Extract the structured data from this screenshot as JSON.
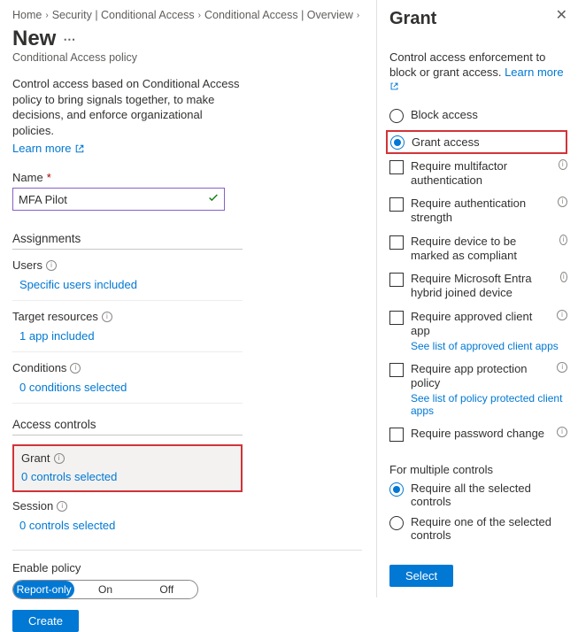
{
  "breadcrumb": {
    "items": [
      "Home",
      "Security | Conditional Access",
      "Conditional Access | Overview"
    ]
  },
  "page": {
    "title": "New",
    "subtitle": "Conditional Access policy",
    "description": "Control access based on Conditional Access policy to bring signals together, to make decisions, and enforce organizational policies.",
    "learn_more": "Learn more"
  },
  "name_field": {
    "label": "Name",
    "value": "MFA Pilot"
  },
  "assignments": {
    "header": "Assignments",
    "users": {
      "label": "Users",
      "link": "Specific users included"
    },
    "targets": {
      "label": "Target resources",
      "link": "1 app included"
    },
    "conditions": {
      "label": "Conditions",
      "link": "0 conditions selected"
    }
  },
  "access": {
    "header": "Access controls",
    "grant": {
      "label": "Grant",
      "link": "0 controls selected"
    },
    "session": {
      "label": "Session",
      "link": "0 controls selected"
    }
  },
  "enable": {
    "label": "Enable policy",
    "options": [
      "Report-only",
      "On",
      "Off"
    ],
    "selected": "Report-only"
  },
  "create_button": "Create",
  "panel": {
    "title": "Grant",
    "desc": "Control access enforcement to block or grant access.",
    "learn_more": "Learn more",
    "access_radio": {
      "block": "Block access",
      "grant": "Grant access",
      "selected": "grant"
    },
    "checks": {
      "mfa": "Require multifactor authentication",
      "strength": "Require authentication strength",
      "compliant": "Require device to be marked as compliant",
      "hybrid": "Require Microsoft Entra hybrid joined device",
      "approved_app": "Require approved client app",
      "approved_app_link": "See list of approved client apps",
      "protection": "Require app protection policy",
      "protection_link": "See list of policy protected client apps",
      "password": "Require password change"
    },
    "multi": {
      "header": "For multiple controls",
      "all": "Require all the selected controls",
      "one": "Require one of the selected controls",
      "selected": "all"
    },
    "select_button": "Select"
  }
}
